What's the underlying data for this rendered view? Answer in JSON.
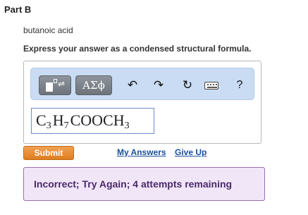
{
  "part": {
    "title": "Part B"
  },
  "question": {
    "compound": "butanoic acid",
    "instruction": "Express your answer as a condensed structural formula."
  },
  "toolbar": {
    "template_icon": "templates-icon",
    "greek_label": "ΑΣϕ",
    "undo_icon": "undo-icon",
    "redo_icon": "redo-icon",
    "reset_icon": "reset-icon",
    "keyboard_icon": "keyboard-icon",
    "help_label": "?"
  },
  "answer": {
    "parts": [
      {
        "text": "C",
        "sub": "3"
      },
      {
        "text": "H",
        "sub": "7"
      },
      {
        "text": "COOCH",
        "sub": "3"
      }
    ]
  },
  "actions": {
    "submit_label": "Submit",
    "my_answers_label": "My Answers",
    "give_up_label": "Give Up"
  },
  "feedback": {
    "message": "Incorrect; Try Again; 4 attempts remaining"
  },
  "colors": {
    "submit": "#e8891f",
    "toolbar_bg": "#c9dcf3",
    "feedback_bg": "#f1e6f8",
    "link": "#1a4fa0"
  }
}
